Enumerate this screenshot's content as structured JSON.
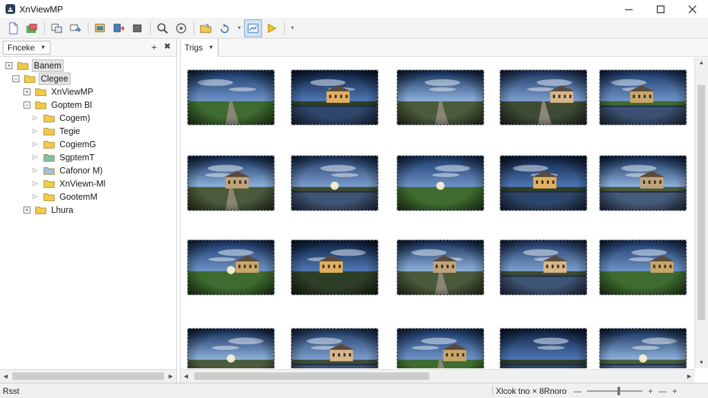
{
  "window": {
    "title": "XnViewMP",
    "controls": [
      "minimize",
      "maximize",
      "close"
    ]
  },
  "toolbar": {
    "buttons": [
      {
        "name": "new-icon"
      },
      {
        "name": "folder-green-icon"
      },
      {
        "name": "copy-icon"
      },
      {
        "name": "move-icon"
      },
      {
        "name": "slideshow-icon"
      },
      {
        "name": "convert-icon"
      },
      {
        "name": "crop-icon"
      },
      {
        "name": "search-icon"
      },
      {
        "name": "settings-icon"
      },
      {
        "name": "open-folder-icon"
      },
      {
        "name": "rotate-icon"
      },
      {
        "name": "view-icon",
        "active": true
      },
      {
        "name": "play-icon"
      }
    ]
  },
  "left_panel": {
    "dropdown_label": "Fnceke",
    "tree": [
      {
        "label": "Banem",
        "level": 0,
        "expander": "+",
        "color": "#f2c94c",
        "selected": true
      },
      {
        "label": "Clegee",
        "level": 1,
        "expander": "−",
        "color": "#f2c94c",
        "selected": true
      },
      {
        "label": "XnViewMP",
        "level": 2,
        "expander": "+",
        "color": "#f2c94c"
      },
      {
        "label": "Goptem Bl",
        "level": 2,
        "expander": "−",
        "color": "#f2c94c"
      },
      {
        "label": "Cogem)",
        "level": 3,
        "expander": "▷",
        "color": "#f2c94c"
      },
      {
        "label": "Tegie",
        "level": 3,
        "expander": "▷",
        "color": "#f2c94c"
      },
      {
        "label": "CogiemG",
        "level": 3,
        "expander": "▷",
        "color": "#f2c94c"
      },
      {
        "label": "SgptemT",
        "level": 3,
        "expander": "▷",
        "color": "#7fbfa8"
      },
      {
        "label": "Cafonor M)",
        "level": 3,
        "expander": "▷",
        "color": "#9cc0e0"
      },
      {
        "label": "XnViewn-Ml",
        "level": 3,
        "expander": "▷",
        "color": "#f2c94c"
      },
      {
        "label": "GootemM",
        "level": 3,
        "expander": "▷",
        "color": "#f2c94c"
      },
      {
        "label": "Lhura",
        "level": 2,
        "expander": "+",
        "color": "#f2c94c"
      }
    ]
  },
  "right_panel": {
    "dropdown_label": "Trigs",
    "thumbnails": [
      {
        "scene": "field-road"
      },
      {
        "scene": "river-tower"
      },
      {
        "scene": "road-clouds"
      },
      {
        "scene": "house-road"
      },
      {
        "scene": "castle-water"
      },
      {
        "scene": "mansion-road"
      },
      {
        "scene": "lake-dusk"
      },
      {
        "scene": "field-sunset"
      },
      {
        "scene": "castle-reflect"
      },
      {
        "scene": "tower-reflect"
      },
      {
        "scene": "mansion-sun"
      },
      {
        "scene": "mansion-front"
      },
      {
        "scene": "mansion-path"
      },
      {
        "scene": "mansion-water"
      },
      {
        "scene": "mansion-trees"
      },
      {
        "scene": "field-sun"
      },
      {
        "scene": "castle-lake"
      },
      {
        "scene": "house-road2"
      },
      {
        "scene": "canal-trees"
      },
      {
        "scene": "canal-dusk"
      }
    ]
  },
  "statusbar": {
    "left": "Rsst",
    "zoom_text": "Xlcok tno × 8Rnoro"
  }
}
